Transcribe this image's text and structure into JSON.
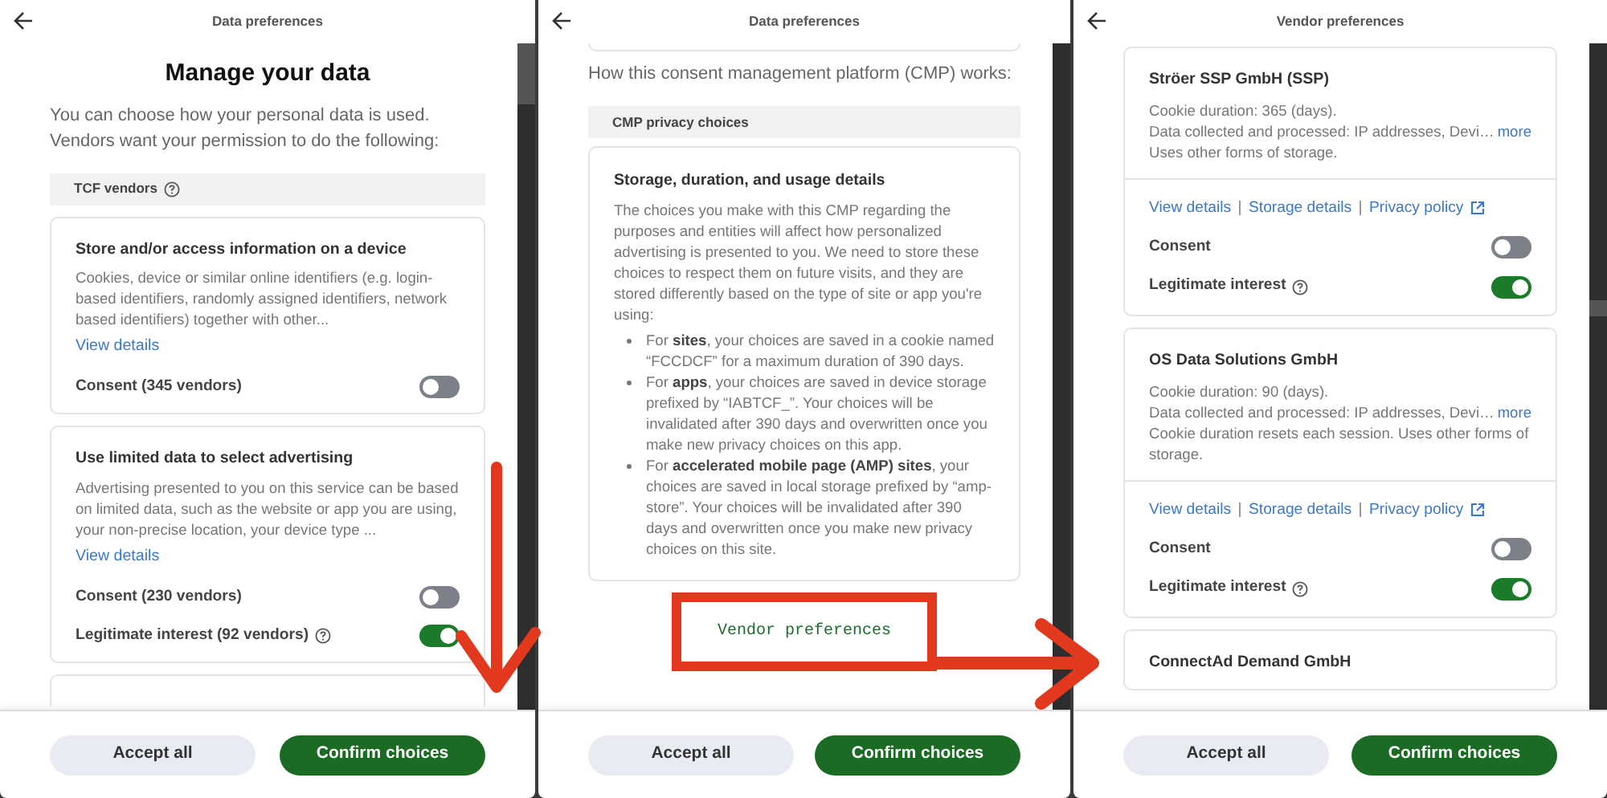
{
  "panels": [
    {
      "title": "Data preferences",
      "blocks": [
        {
          "kind": "heading",
          "text": "Manage your data"
        },
        {
          "kind": "intro",
          "text": "You can choose how your personal data is used. Vendors want your permission to do the following:"
        },
        {
          "kind": "section",
          "label": "TCF vendors",
          "help": true
        },
        {
          "kind": "purpose_card",
          "title": "Store and/or access information on a device",
          "description": "Cookies, device or similar online identifiers (e.g. login-based identifiers, randomly assigned identifiers, network based identifiers) together with other...",
          "link": "View details",
          "toggles": [
            {
              "label": "Consent (345 vendors)",
              "help": false,
              "on": false
            }
          ]
        },
        {
          "kind": "purpose_card",
          "title": "Use limited data to select advertising",
          "description": "Advertising presented to you on this service can be based on limited data, such as the website or app you are using, your non-precise location, your device type ...",
          "link": "View details",
          "toggles": [
            {
              "label": "Consent (230 vendors)",
              "help": false,
              "on": false
            },
            {
              "label": "Legitimate interest (92 vendors)",
              "help": true,
              "on": true
            }
          ]
        },
        {
          "kind": "card_edge_bottom"
        }
      ],
      "buttons": [
        {
          "label": "Accept all",
          "kind": "secondary"
        },
        {
          "label": "Confirm choices",
          "kind": "primary"
        }
      ]
    },
    {
      "title": "Data preferences",
      "blocks": [
        {
          "kind": "card_edge_top"
        },
        {
          "kind": "intro",
          "text": "How this consent management platform (CMP) works:"
        },
        {
          "kind": "section",
          "label": "CMP privacy choices",
          "help": false
        },
        {
          "kind": "info_card",
          "title": "Storage, duration, and usage details",
          "paragraph": "The choices you make with this CMP regarding the purposes and entities will affect how personalized advertising is presented to you. We need to store these choices to respect them on future visits, and they are stored differently based on the type of site or app you're using:",
          "bullets": [
            "For **sites**, your choices are saved in a cookie named “FCCDCF” for a maximum duration of 390 days.",
            "For **apps**, your choices are saved in device storage prefixed by “IABTCF_”. Your choices will be invalidated after 390 days and overwritten once you make new privacy choices on this app.",
            "For **accelerated mobile page (AMP) sites**, your choices are saved in local storage prefixed by “amp-store”. Your choices will be invalidated after 390 days and overwritten once you make new privacy choices on this site."
          ]
        },
        {
          "kind": "link",
          "label": "Vendor preferences",
          "highlighted": true
        }
      ],
      "buttons": [
        {
          "label": "Accept all",
          "kind": "secondary"
        },
        {
          "label": "Confirm choices",
          "kind": "primary"
        }
      ]
    },
    {
      "title": "Vendor preferences",
      "blocks": [
        {
          "kind": "vendor_card",
          "name": "Ströer SSP GmbH (SSP)",
          "details": [
            {
              "text": "Cookie duration: 365 (days)."
            },
            {
              "text": "Data collected and processed: IP addresses, Devi…",
              "more": "more"
            },
            {
              "text": "Uses other forms of storage."
            }
          ],
          "links": [
            {
              "label": "View details",
              "external": false
            },
            {
              "label": "Storage details",
              "external": false
            },
            {
              "label": "Privacy policy",
              "external": true
            }
          ],
          "toggles": [
            {
              "label": "Consent",
              "help": false,
              "on": false
            },
            {
              "label": "Legitimate interest",
              "help": true,
              "on": true
            }
          ]
        },
        {
          "kind": "vendor_card",
          "name": "OS Data Solutions GmbH",
          "details": [
            {
              "text": "Cookie duration: 90 (days)."
            },
            {
              "text": "Data collected and processed: IP addresses, Devi…",
              "more": "more"
            },
            {
              "text": "Cookie duration resets each session. Uses other forms of storage."
            }
          ],
          "links": [
            {
              "label": "View details",
              "external": false
            },
            {
              "label": "Storage details",
              "external": false
            },
            {
              "label": "Privacy policy",
              "external": true
            }
          ],
          "toggles": [
            {
              "label": "Consent",
              "help": false,
              "on": false
            },
            {
              "label": "Legitimate interest",
              "help": true,
              "on": true
            }
          ]
        },
        {
          "kind": "vendor_card",
          "name": "ConnectAd Demand GmbH"
        }
      ],
      "buttons": [
        {
          "label": "Accept all",
          "kind": "secondary"
        },
        {
          "label": "Confirm choices",
          "kind": "primary"
        }
      ]
    }
  ]
}
